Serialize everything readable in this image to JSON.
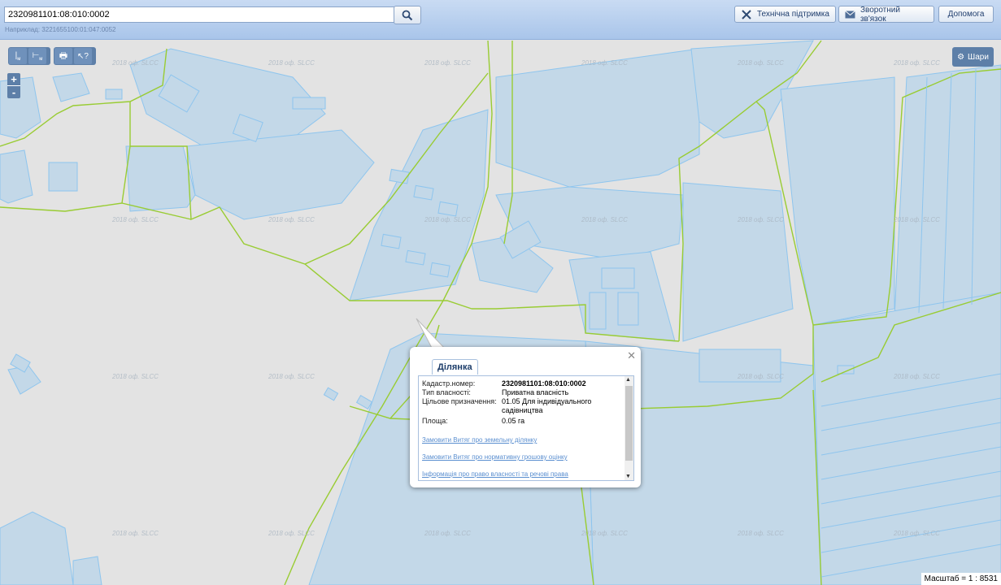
{
  "search": {
    "value": "2320981101:08:010:0002",
    "hint": "Наприклад: 3221655100:01:047:0052"
  },
  "header": {
    "support_label": "Технічна підтримка",
    "feedback_label": "Зворотний зв'язок",
    "help_label": "Допомога"
  },
  "map": {
    "watermark": "2018 оф. SLCC",
    "layers_label": "Шари",
    "zoom_in": "+",
    "zoom_out": "-",
    "scale_label": "Масштаб = 1 : 8531"
  },
  "popup": {
    "tab_label": "Ділянка",
    "rows": [
      {
        "label": "Кадастр.номер:",
        "value": "2320981101:08:010:0002"
      },
      {
        "label": "Тип власності:",
        "value": "Приватна власність"
      },
      {
        "label": "Цільове призначення:",
        "value": "01.05 Для індивідуального садівництва"
      },
      {
        "label": "Площа:",
        "value": "0.05 га"
      }
    ],
    "links": [
      "Замовити Витяг про земельну ділянку",
      "Замовити Витяг про нормативну грошову оцінку",
      "Інформація про право власності та речові права"
    ]
  },
  "colors": {
    "parcel_fill": "#c3d8e8",
    "parcel_stroke": "#8ec5ee",
    "boundary": "#99cc33",
    "background": "#e3e3e3"
  }
}
